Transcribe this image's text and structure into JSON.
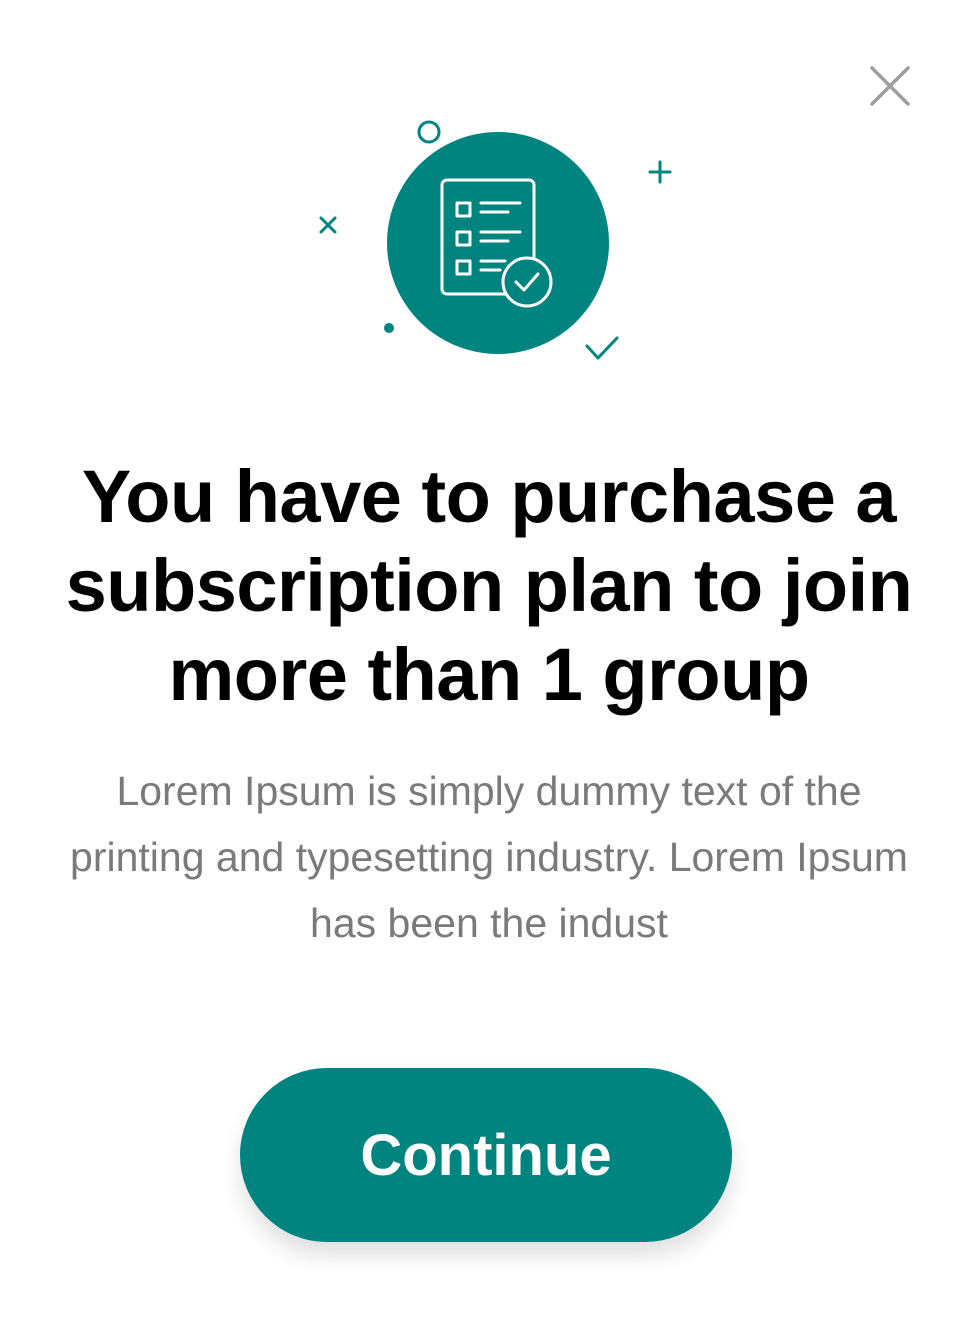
{
  "dialog": {
    "title": "You have to purchase a subscription plan to join more than 1 group",
    "message": "Lorem Ipsum is simply dummy text of the printing and typesetting industry. Lorem Ipsum has been the indust",
    "continue_label": "Continue",
    "close_icon": "close-icon",
    "illustration_icon": "checklist-document-icon"
  },
  "colors": {
    "accent": "#008480",
    "title": "#000000",
    "message": "#7a7a7a",
    "close_icon": "#9e9e9e"
  }
}
